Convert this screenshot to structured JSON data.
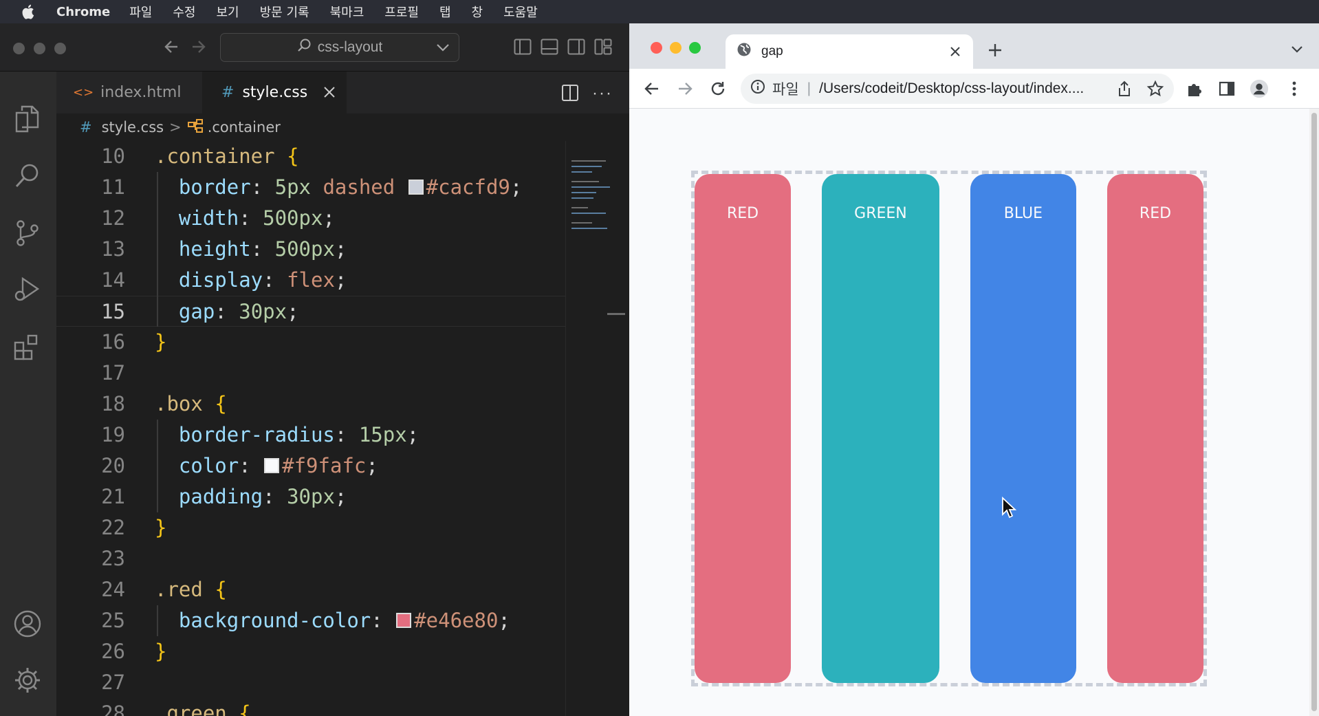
{
  "menubar": {
    "app": "Chrome",
    "items": [
      "파일",
      "수정",
      "보기",
      "방문 기록",
      "북마크",
      "프로필",
      "탭",
      "창",
      "도움말"
    ]
  },
  "vscode": {
    "search_text": "css-layout",
    "tabs": [
      {
        "icon_text": "<>",
        "label": "index.html",
        "active": false
      },
      {
        "icon_text": "#",
        "label": "style.css",
        "active": true
      }
    ],
    "breadcrumb": {
      "hash": "#",
      "file": "style.css",
      "sep": ">",
      "symbol": ".container"
    },
    "lines": [
      {
        "n": "10",
        "tokens": [
          {
            "t": ".container ",
            "c": "sel"
          },
          {
            "t": "{",
            "c": "brace"
          }
        ]
      },
      {
        "n": "11",
        "tokens": [
          {
            "t": "  border",
            "c": "prop"
          },
          {
            "t": ": ",
            "c": "punc"
          },
          {
            "t": "5px ",
            "c": "num"
          },
          {
            "t": "dashed ",
            "c": "val"
          },
          {
            "swatch": "#cacfd9"
          },
          {
            "t": "#cacfd9",
            "c": "val"
          },
          {
            "t": ";",
            "c": "punc"
          }
        ]
      },
      {
        "n": "12",
        "tokens": [
          {
            "t": "  width",
            "c": "prop"
          },
          {
            "t": ": ",
            "c": "punc"
          },
          {
            "t": "500px",
            "c": "num"
          },
          {
            "t": ";",
            "c": "punc"
          }
        ]
      },
      {
        "n": "13",
        "tokens": [
          {
            "t": "  height",
            "c": "prop"
          },
          {
            "t": ": ",
            "c": "punc"
          },
          {
            "t": "500px",
            "c": "num"
          },
          {
            "t": ";",
            "c": "punc"
          }
        ]
      },
      {
        "n": "14",
        "tokens": [
          {
            "t": "  display",
            "c": "prop"
          },
          {
            "t": ": ",
            "c": "punc"
          },
          {
            "t": "flex",
            "c": "val"
          },
          {
            "t": ";",
            "c": "punc"
          }
        ]
      },
      {
        "n": "15",
        "current": true,
        "tokens": [
          {
            "t": "  gap",
            "c": "prop"
          },
          {
            "t": ": ",
            "c": "punc"
          },
          {
            "t": "30px",
            "c": "num"
          },
          {
            "t": ";",
            "c": "punc"
          }
        ]
      },
      {
        "n": "16",
        "tokens": [
          {
            "t": "}",
            "c": "brace"
          }
        ]
      },
      {
        "n": "17",
        "tokens": []
      },
      {
        "n": "18",
        "tokens": [
          {
            "t": ".box ",
            "c": "sel"
          },
          {
            "t": "{",
            "c": "brace"
          }
        ]
      },
      {
        "n": "19",
        "tokens": [
          {
            "t": "  border-radius",
            "c": "prop"
          },
          {
            "t": ": ",
            "c": "punc"
          },
          {
            "t": "15px",
            "c": "num"
          },
          {
            "t": ";",
            "c": "punc"
          }
        ]
      },
      {
        "n": "20",
        "tokens": [
          {
            "t": "  color",
            "c": "prop"
          },
          {
            "t": ": ",
            "c": "punc"
          },
          {
            "swatch": "#f9fafc"
          },
          {
            "t": "#f9fafc",
            "c": "val"
          },
          {
            "t": ";",
            "c": "punc"
          }
        ]
      },
      {
        "n": "21",
        "tokens": [
          {
            "t": "  padding",
            "c": "prop"
          },
          {
            "t": ": ",
            "c": "punc"
          },
          {
            "t": "30px",
            "c": "num"
          },
          {
            "t": ";",
            "c": "punc"
          }
        ]
      },
      {
        "n": "22",
        "tokens": [
          {
            "t": "}",
            "c": "brace"
          }
        ]
      },
      {
        "n": "23",
        "tokens": []
      },
      {
        "n": "24",
        "tokens": [
          {
            "t": ".red ",
            "c": "sel"
          },
          {
            "t": "{",
            "c": "brace"
          }
        ]
      },
      {
        "n": "25",
        "tokens": [
          {
            "t": "  background-color",
            "c": "prop"
          },
          {
            "t": ": ",
            "c": "punc"
          },
          {
            "swatch": "#e46e80"
          },
          {
            "t": "#e46e80",
            "c": "val"
          },
          {
            "t": ";",
            "c": "punc"
          }
        ]
      },
      {
        "n": "26",
        "tokens": [
          {
            "t": "}",
            "c": "brace"
          }
        ]
      },
      {
        "n": "27",
        "tokens": []
      },
      {
        "n": "28",
        "tokens": [
          {
            "t": ".green ",
            "c": "sel"
          },
          {
            "t": "{",
            "c": "brace"
          }
        ]
      }
    ]
  },
  "chrome": {
    "tab_title": "gap",
    "address_scheme": "파일",
    "address_path": "/Users/codeit/Desktop/css-layout/index....",
    "boxes": [
      {
        "label": "RED",
        "color": "#e46e80",
        "flex": 1
      },
      {
        "label": "GREEN",
        "color": "#2cb1bc",
        "flex": 1.22
      },
      {
        "label": "BLUE",
        "color": "#4285e6",
        "flex": 1.1
      },
      {
        "label": "RED",
        "color": "#e46e80",
        "flex": 1
      }
    ],
    "container_border_color": "#cacfd9"
  }
}
